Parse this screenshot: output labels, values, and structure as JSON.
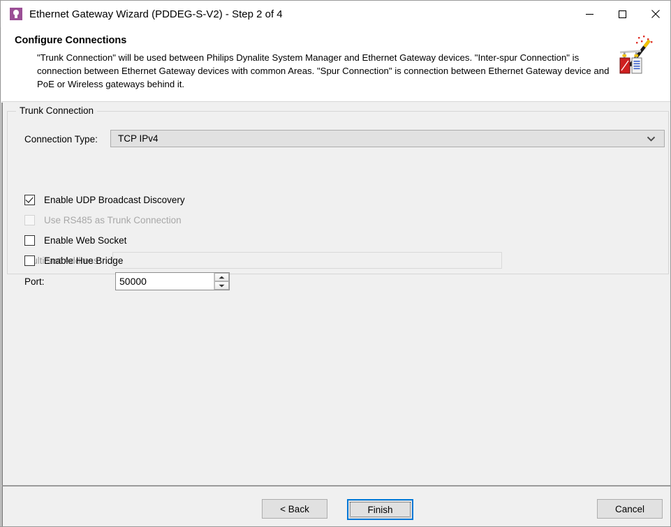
{
  "window": {
    "title": "Ethernet Gateway Wizard (PDDEG-S-V2) - Step 2 of 4",
    "icon": "lightbulb-icon",
    "accent_color": "#9b4f96",
    "focus_color": "#0078d7",
    "controls": {
      "minimize": "minimize-icon",
      "maximize": "maximize-icon",
      "close": "close-icon"
    }
  },
  "header": {
    "title": "Configure Connections",
    "description": "\"Trunk Connection\" will be used between Philips Dynalite System Manager and Ethernet Gateway devices. \"Inter-spur Connection\" is connection between Ethernet Gateway devices with common Areas. \"Spur Connection\" is connection between Ethernet Gateway device and PoE or Wireless gateways behind it.",
    "icon": "wizard-wand-icon"
  },
  "group": {
    "legend": "Trunk Connection",
    "fields": {
      "connection_type": {
        "label": "Connection Type:",
        "value": "TCP IPv4",
        "control": "combobox",
        "arrow_icon": "chevron-down-icon"
      },
      "multicast_address": {
        "label": "Multicast Address:",
        "value": "",
        "placeholder": "",
        "control": "textbox",
        "enabled": false
      },
      "port": {
        "label": "Port:",
        "value": "50000",
        "control": "spinner",
        "up_icon": "spinner-up-icon",
        "down_icon": "spinner-down-icon"
      }
    },
    "checkboxes": [
      {
        "label": "Enable UDP Broadcast Discovery",
        "checked": true,
        "enabled": true
      },
      {
        "label": "Use RS485 as Trunk Connection",
        "checked": false,
        "enabled": false
      },
      {
        "label": "Enable Web Socket",
        "checked": false,
        "enabled": true
      },
      {
        "label": "Enable Hue Bridge",
        "checked": false,
        "enabled": true
      }
    ]
  },
  "footer": {
    "back": "< Back",
    "finish": "Finish",
    "cancel": "Cancel"
  }
}
